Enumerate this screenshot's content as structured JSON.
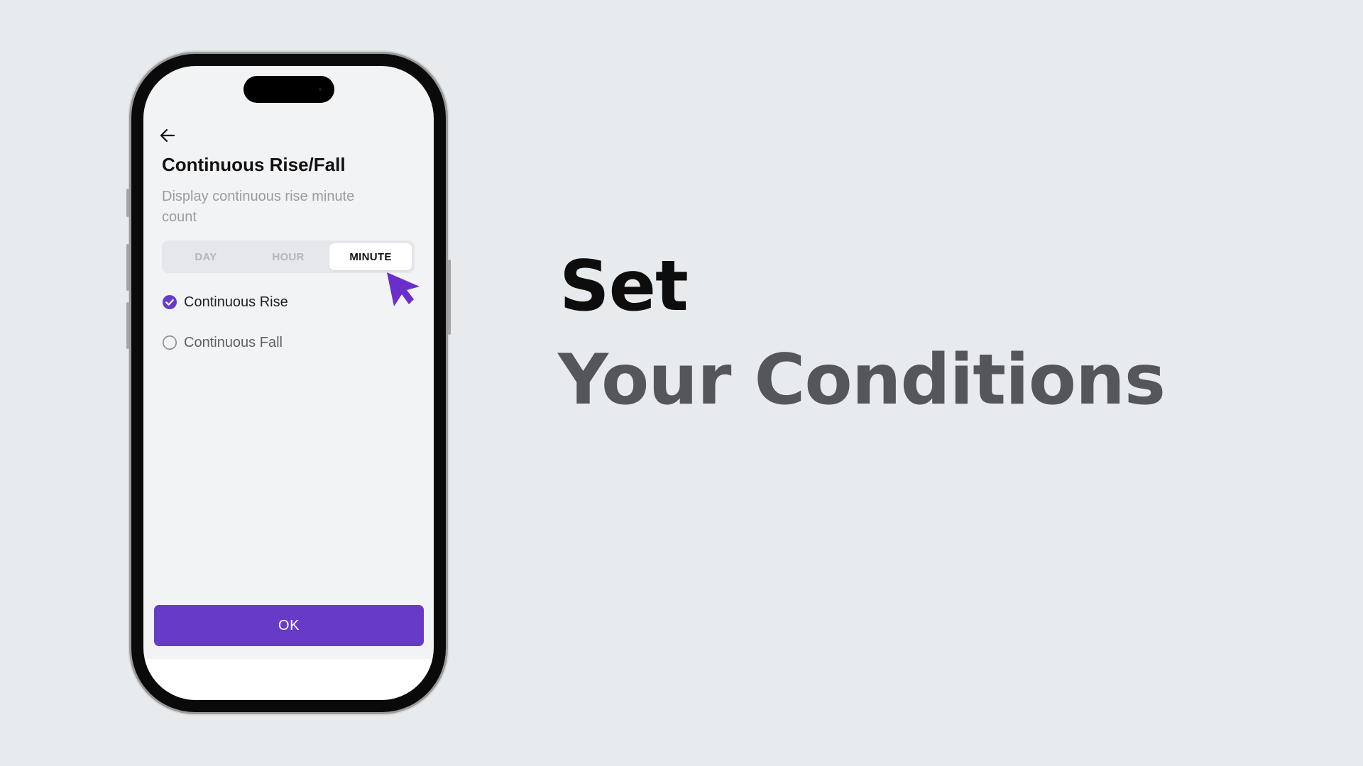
{
  "screen": {
    "title": "Continuous Rise/Fall",
    "subtitle": "Display continuous rise minute count",
    "tabs": [
      {
        "label": "DAY",
        "active": false
      },
      {
        "label": "HOUR",
        "active": false
      },
      {
        "label": "MINUTE",
        "active": true
      }
    ],
    "options": [
      {
        "label": "Continuous Rise",
        "checked": true
      },
      {
        "label": "Continuous Fall",
        "checked": false
      }
    ],
    "ok_label": "OK"
  },
  "headline": {
    "line1": "Set",
    "line2": "Your Conditions"
  },
  "colors": {
    "accent": "#673bc8",
    "cursor": "#6b2fc9",
    "background": "#e8ebee"
  },
  "icons": {
    "back": "arrow-left-icon",
    "cursor": "pointer-cursor-icon",
    "checked": "check-circle-icon",
    "unchecked": "radio-empty-icon"
  }
}
